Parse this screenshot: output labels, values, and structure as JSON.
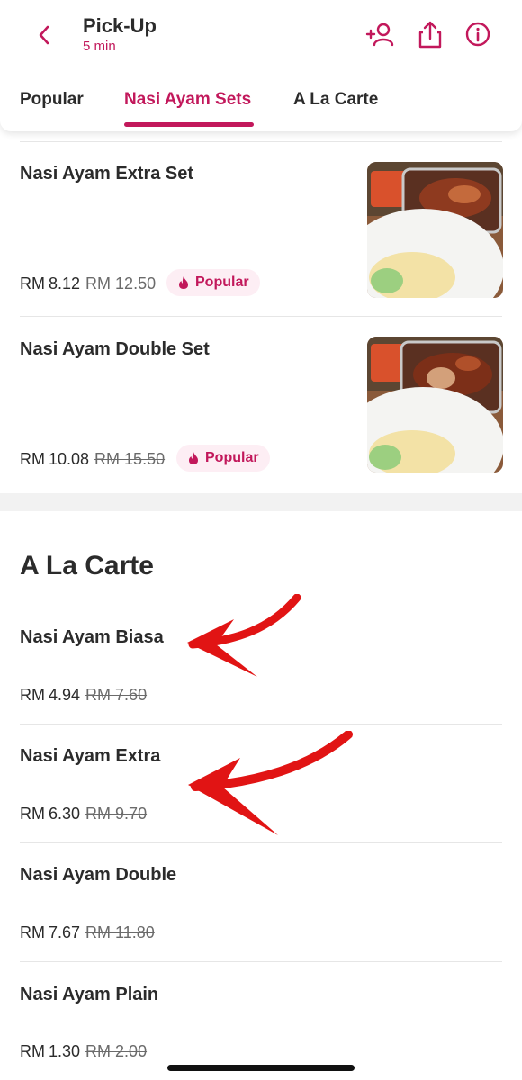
{
  "header": {
    "title": "Pick-Up",
    "subtitle": "5 min",
    "icons": [
      "back-chevron-icon",
      "add-person-icon",
      "share-icon",
      "info-icon"
    ],
    "accent_color": "#c2185b"
  },
  "tabs": [
    {
      "label": "Popular",
      "active": false
    },
    {
      "label": "Nasi Ayam Sets",
      "active": true
    },
    {
      "label": "A La Carte",
      "active": false
    }
  ],
  "sets": [
    {
      "name": "Nasi Ayam Extra Set",
      "currency": "RM",
      "price": "8.12",
      "old_price": "RM 12.50",
      "badge": "Popular"
    },
    {
      "name": "Nasi Ayam Double Set",
      "currency": "RM",
      "price": "10.08",
      "old_price": "RM 15.50",
      "badge": "Popular"
    }
  ],
  "a_la_carte": {
    "title": "A La Carte",
    "items": [
      {
        "name": "Nasi Ayam Biasa",
        "currency": "RM",
        "price": "4.94",
        "old_price": "RM 7.60"
      },
      {
        "name": "Nasi Ayam Extra",
        "currency": "RM",
        "price": "6.30",
        "old_price": "RM 9.70"
      },
      {
        "name": "Nasi Ayam Double",
        "currency": "RM",
        "price": "7.67",
        "old_price": "RM 11.80"
      },
      {
        "name": "Nasi Ayam Plain",
        "currency": "RM",
        "price": "1.30",
        "old_price": "RM 2.00"
      }
    ]
  },
  "annotation_color": "#e11414"
}
